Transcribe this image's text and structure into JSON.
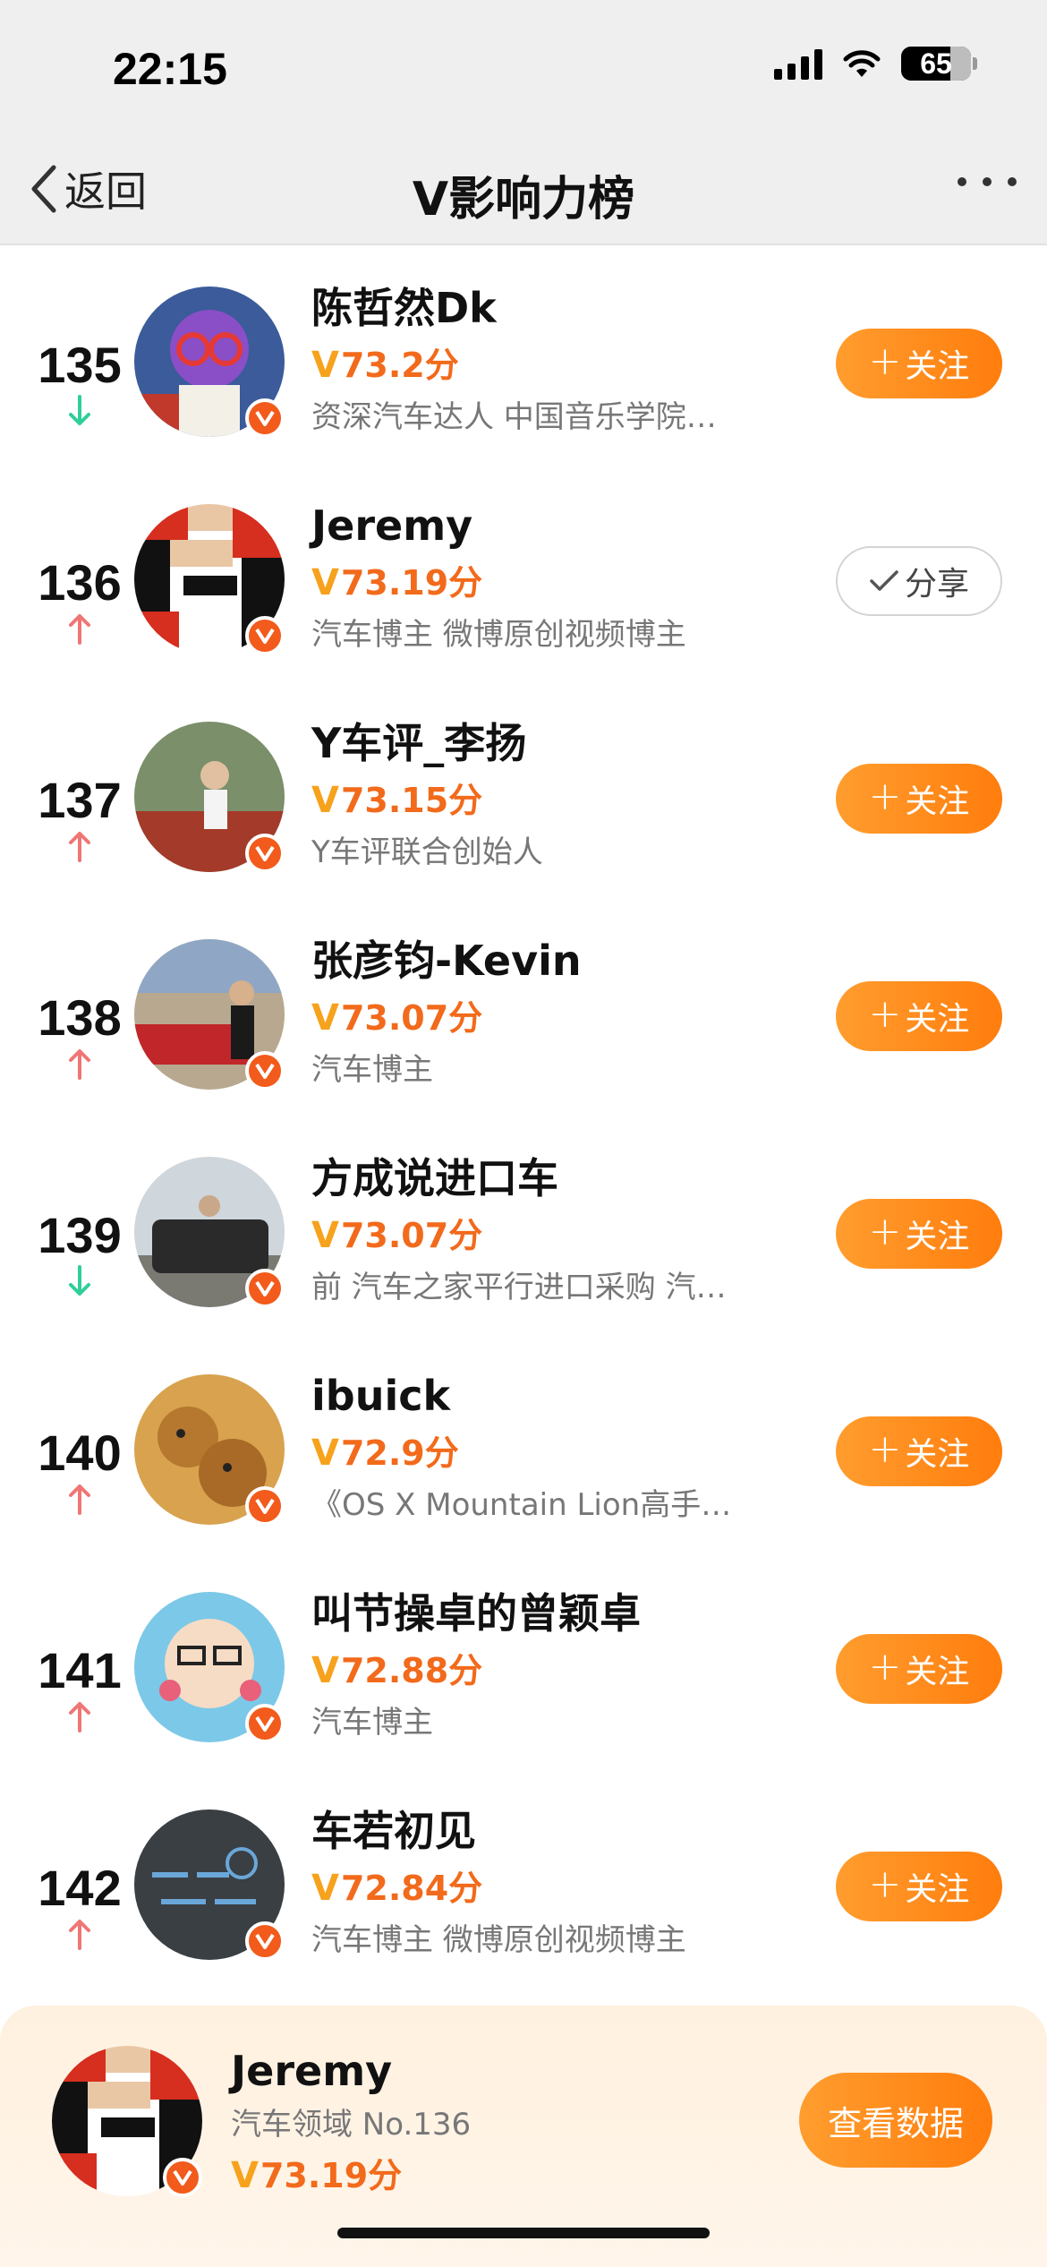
{
  "status_bar": {
    "time": "22:15",
    "battery": "65"
  },
  "nav": {
    "back_label": "返回",
    "title": "V影响力榜"
  },
  "buttons": {
    "follow_label": "关注",
    "share_label": "分享"
  },
  "rows": [
    {
      "rank": "135",
      "trend": "down",
      "name": "陈哲然Dk",
      "score": "73.2分",
      "desc": "资深汽车达人 中国音乐学院…",
      "action": "follow"
    },
    {
      "rank": "136",
      "trend": "up",
      "name": "Jeremy",
      "score": "73.19分",
      "desc": "汽车博主 微博原创视频博主",
      "action": "share"
    },
    {
      "rank": "137",
      "trend": "up",
      "name": "Y车评_李扬",
      "score": "73.15分",
      "desc": "Y车评联合创始人",
      "action": "follow"
    },
    {
      "rank": "138",
      "trend": "up",
      "name": "张彦钧-Kevin",
      "score": "73.07分",
      "desc": "汽车博主",
      "action": "follow"
    },
    {
      "rank": "139",
      "trend": "down",
      "name": "方成说进口车",
      "score": "73.07分",
      "desc": "前 汽车之家平行进口采购 汽…",
      "action": "follow"
    },
    {
      "rank": "140",
      "trend": "up",
      "name": "ibuick",
      "score": "72.9分",
      "desc": "《OS X Mountain Lion高手进…",
      "action": "follow"
    },
    {
      "rank": "141",
      "trend": "up",
      "name": "叫节操卓的曾颖卓",
      "score": "72.88分",
      "desc": "汽车博主",
      "action": "follow"
    },
    {
      "rank": "142",
      "trend": "up",
      "name": "车若初见",
      "score": "72.84分",
      "desc": "汽车博主 微博原创视频博主",
      "action": "follow"
    }
  ],
  "my_card": {
    "name": "Jeremy",
    "field": "汽车领域 No.136",
    "score": "73.19分",
    "button_label": "查看数据"
  },
  "colors": {
    "accent": "#ff8a1e",
    "score": "#f26a1b",
    "up": "#f07575",
    "down": "#2fcf9a",
    "badge": "#f25b1b"
  }
}
